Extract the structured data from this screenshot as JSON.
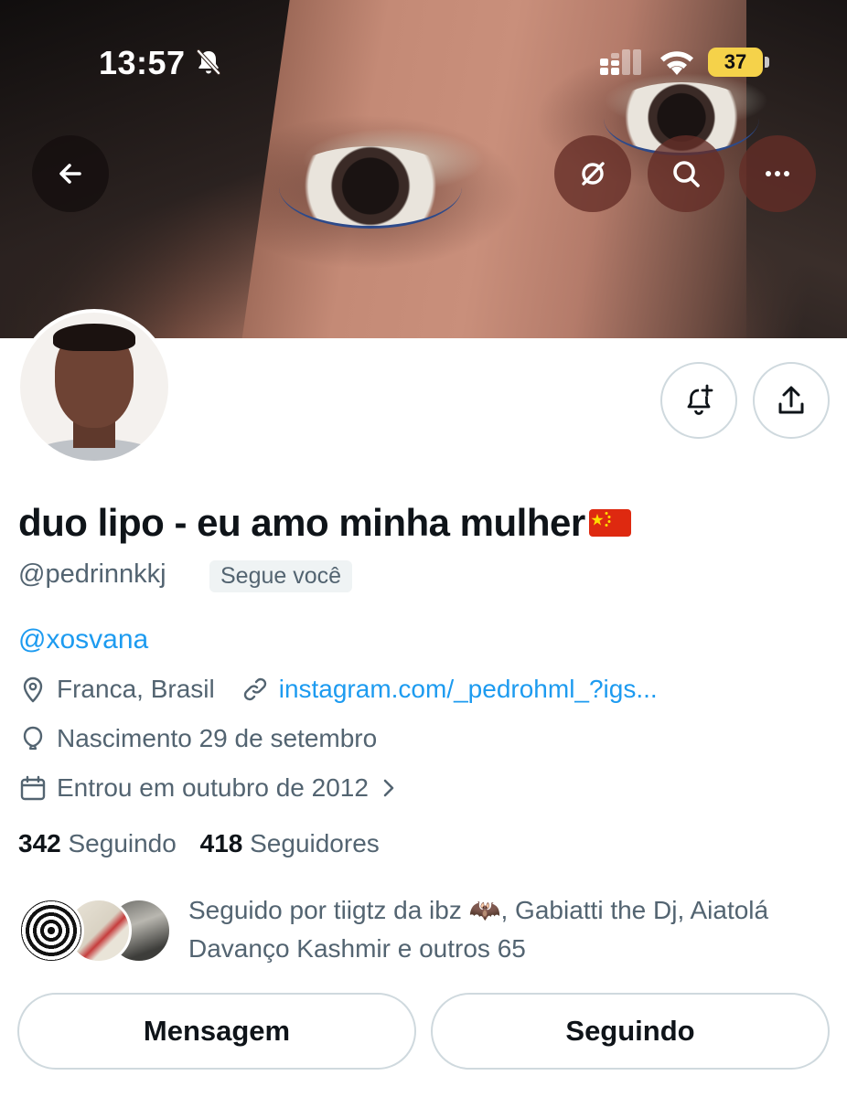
{
  "status_bar": {
    "time": "13:57",
    "silent_icon": "bell-slash-icon",
    "battery_level": "37",
    "battery_color": "#f5d24a"
  },
  "header": {
    "back_icon": "arrow-left-icon",
    "actions": [
      "grok-icon",
      "search-icon",
      "more-icon"
    ]
  },
  "profile": {
    "display_name": "duo lipo - eu amo minha mulher",
    "name_emoji": "china-flag-icon",
    "handle": "@pedrinnkkj",
    "follows_you": "Segue você",
    "bio": "@xosvana",
    "location": "Franca, Brasil",
    "website": "instagram.com/_pedrohml_?igs...",
    "birthday": "Nascimento 29 de setembro",
    "joined": "Entrou em outubro de 2012",
    "following_count": "342",
    "following_label": "Seguindo",
    "followers_count": "418",
    "followers_label": "Seguidores"
  },
  "known_followers": {
    "text": "Seguido por tiigtz da ibz 🦇, Gabiatti the Dj, Aiatolá Davanço Kashmir e outros 65"
  },
  "buttons": {
    "message": "Mensagem",
    "following": "Seguindo"
  },
  "colors": {
    "link": "#1d9bf0",
    "secondary_text": "#536471",
    "primary_text": "#0f1419",
    "border": "#cfd9de"
  }
}
